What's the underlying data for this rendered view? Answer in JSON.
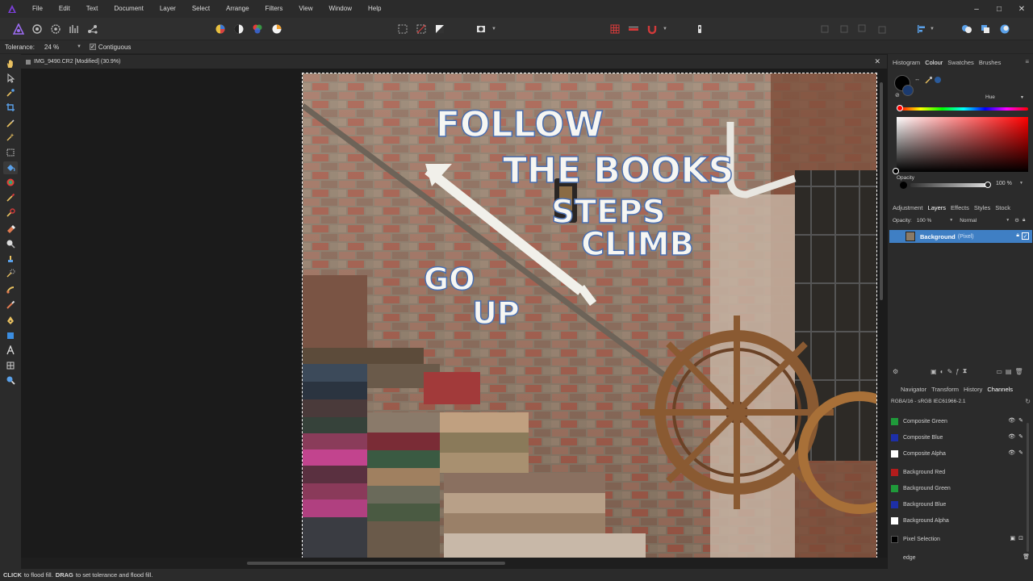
{
  "menu": [
    "File",
    "Edit",
    "Text",
    "Document",
    "Layer",
    "Select",
    "Arrange",
    "Filters",
    "View",
    "Window",
    "Help"
  ],
  "window_controls": {
    "minimize": "–",
    "maximize": "□",
    "close": "✕"
  },
  "context": {
    "tolerance_label": "Tolerance:",
    "tolerance_value": "24 %",
    "contiguous_label": "Contiguous",
    "contiguous_checked": true
  },
  "document": {
    "tab_title": "IMG_9490.CR2 [Modified] (30.9%)",
    "close": "✕"
  },
  "photo_text": {
    "line1": "FOLLOW",
    "line2": "THE BOOKS",
    "line3": "STEPS",
    "line4": "CLIMB",
    "line5": "GO",
    "line6": "UP"
  },
  "colour_panel": {
    "tabs": [
      "Histogram",
      "Colour",
      "Swatches",
      "Brushes"
    ],
    "active_tab": "Colour",
    "mode": "Hue",
    "opacity_label": "Opacity",
    "opacity_value": "100 %",
    "fg_color": "#000000",
    "bg_color": "#1b3a6e"
  },
  "layers_panel": {
    "tabs": [
      "Adjustment",
      "Layers",
      "Effects",
      "Styles",
      "Stock"
    ],
    "active_tab": "Layers",
    "opacity_label": "Opacity:",
    "opacity_value": "100 %",
    "blend_mode": "Normal",
    "layer_name": "Background",
    "layer_type": "(Pixel)",
    "selection_color": "#3f7fc4"
  },
  "channels_panel": {
    "tabs": [
      "Navigator",
      "Transform",
      "History",
      "Channels"
    ],
    "active_tab": "Channels",
    "profile": "RGBA/16 - sRGB IEC61966-2.1",
    "channels": [
      {
        "name": "Composite Green",
        "color": "#1f9a3a"
      },
      {
        "name": "Composite Blue",
        "color": "#1d2fa8"
      },
      {
        "name": "Composite Alpha",
        "color": "#ffffff"
      },
      {
        "name": "Background Red",
        "color": "#b21c1c"
      },
      {
        "name": "Background Green",
        "color": "#1f9a3a"
      },
      {
        "name": "Background Blue",
        "color": "#1d2fa8"
      },
      {
        "name": "Background Alpha",
        "color": "#ffffff"
      },
      {
        "name": "Pixel Selection",
        "color": "#000000"
      },
      {
        "name": "edge",
        "color": "#2b2b2b"
      }
    ]
  },
  "status": {
    "click": "CLICK",
    "click_text": "to flood fill.",
    "drag": "DRAG",
    "drag_text": "to set tolerance and flood fill."
  }
}
